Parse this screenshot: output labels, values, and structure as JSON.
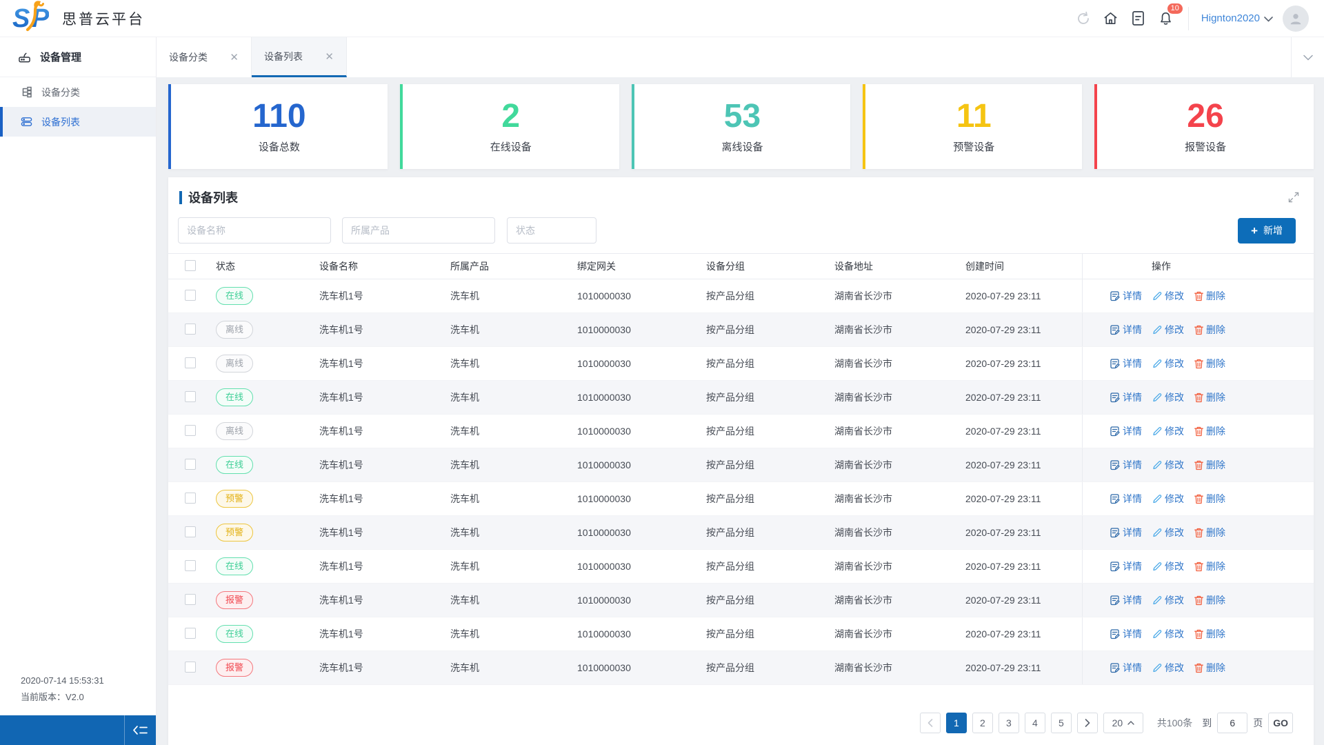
{
  "app": {
    "title": "思普云平台",
    "logo_s": "S",
    "logo_p": "P"
  },
  "header": {
    "notification_count": "10",
    "username": "Hignton2020"
  },
  "sidebar": {
    "group_label": "设备管理",
    "items": [
      {
        "label": "设备分类"
      },
      {
        "label": "设备列表"
      }
    ],
    "footer": {
      "timestamp": "2020-07-14 15:53:31",
      "version": "当前版本：V2.0"
    }
  },
  "tabs": [
    {
      "label": "设备分类"
    },
    {
      "label": "设备列表"
    }
  ],
  "stats": [
    {
      "value": "110",
      "label": "设备总数",
      "color": "#2566ce"
    },
    {
      "value": "2",
      "label": "在线设备",
      "color": "#41d99b"
    },
    {
      "value": "53",
      "label": "离线设备",
      "color": "#4dc5b5"
    },
    {
      "value": "11",
      "label": "预警设备",
      "color": "#f5c412"
    },
    {
      "value": "26",
      "label": "报警设备",
      "color": "#f4434c"
    }
  ],
  "panel": {
    "title": "设备列表",
    "filters": [
      {
        "placeholder": "设备名称"
      },
      {
        "placeholder": "所属产品"
      },
      {
        "placeholder": "状态"
      }
    ],
    "add_button": "新增",
    "table": {
      "headers": [
        "状态",
        "设备名称",
        "所属产品",
        "绑定网关",
        "设备分组",
        "设备地址",
        "创建时间",
        "操作"
      ],
      "actions": {
        "detail": "详情",
        "edit": "修改",
        "delete": "删除"
      },
      "rows": [
        {
          "status_type": "online",
          "status": "在线",
          "name": "洗车机1号",
          "product": "洗车机",
          "gateway": "1010000030",
          "group": "按产品分组",
          "address": "湖南省长沙市",
          "created": "2020-07-29 23:11"
        },
        {
          "status_type": "offline",
          "status": "离线",
          "name": "洗车机1号",
          "product": "洗车机",
          "gateway": "1010000030",
          "group": "按产品分组",
          "address": "湖南省长沙市",
          "created": "2020-07-29 23:11"
        },
        {
          "status_type": "offline",
          "status": "离线",
          "name": "洗车机1号",
          "product": "洗车机",
          "gateway": "1010000030",
          "group": "按产品分组",
          "address": "湖南省长沙市",
          "created": "2020-07-29 23:11"
        },
        {
          "status_type": "online",
          "status": "在线",
          "name": "洗车机1号",
          "product": "洗车机",
          "gateway": "1010000030",
          "group": "按产品分组",
          "address": "湖南省长沙市",
          "created": "2020-07-29 23:11"
        },
        {
          "status_type": "offline",
          "status": "离线",
          "name": "洗车机1号",
          "product": "洗车机",
          "gateway": "1010000030",
          "group": "按产品分组",
          "address": "湖南省长沙市",
          "created": "2020-07-29 23:11"
        },
        {
          "status_type": "online",
          "status": "在线",
          "name": "洗车机1号",
          "product": "洗车机",
          "gateway": "1010000030",
          "group": "按产品分组",
          "address": "湖南省长沙市",
          "created": "2020-07-29 23:11"
        },
        {
          "status_type": "warning",
          "status": "预警",
          "name": "洗车机1号",
          "product": "洗车机",
          "gateway": "1010000030",
          "group": "按产品分组",
          "address": "湖南省长沙市",
          "created": "2020-07-29 23:11"
        },
        {
          "status_type": "warning",
          "status": "预警",
          "name": "洗车机1号",
          "product": "洗车机",
          "gateway": "1010000030",
          "group": "按产品分组",
          "address": "湖南省长沙市",
          "created": "2020-07-29 23:11"
        },
        {
          "status_type": "online",
          "status": "在线",
          "name": "洗车机1号",
          "product": "洗车机",
          "gateway": "1010000030",
          "group": "按产品分组",
          "address": "湖南省长沙市",
          "created": "2020-07-29 23:11"
        },
        {
          "status_type": "alarm",
          "status": "报警",
          "name": "洗车机1号",
          "product": "洗车机",
          "gateway": "1010000030",
          "group": "按产品分组",
          "address": "湖南省长沙市",
          "created": "2020-07-29 23:11"
        },
        {
          "status_type": "online",
          "status": "在线",
          "name": "洗车机1号",
          "product": "洗车机",
          "gateway": "1010000030",
          "group": "按产品分组",
          "address": "湖南省长沙市",
          "created": "2020-07-29 23:11"
        },
        {
          "status_type": "alarm",
          "status": "报警",
          "name": "洗车机1号",
          "product": "洗车机",
          "gateway": "1010000030",
          "group": "按产品分组",
          "address": "湖南省长沙市",
          "created": "2020-07-29 23:11"
        }
      ]
    },
    "pagination": {
      "pages": [
        "1",
        "2",
        "3",
        "4",
        "5"
      ],
      "active_page": "1",
      "page_size": "20",
      "total_text": "共100条",
      "jump_label": "到",
      "jump_value": "6",
      "page_unit": "页",
      "go_label": "GO"
    }
  }
}
